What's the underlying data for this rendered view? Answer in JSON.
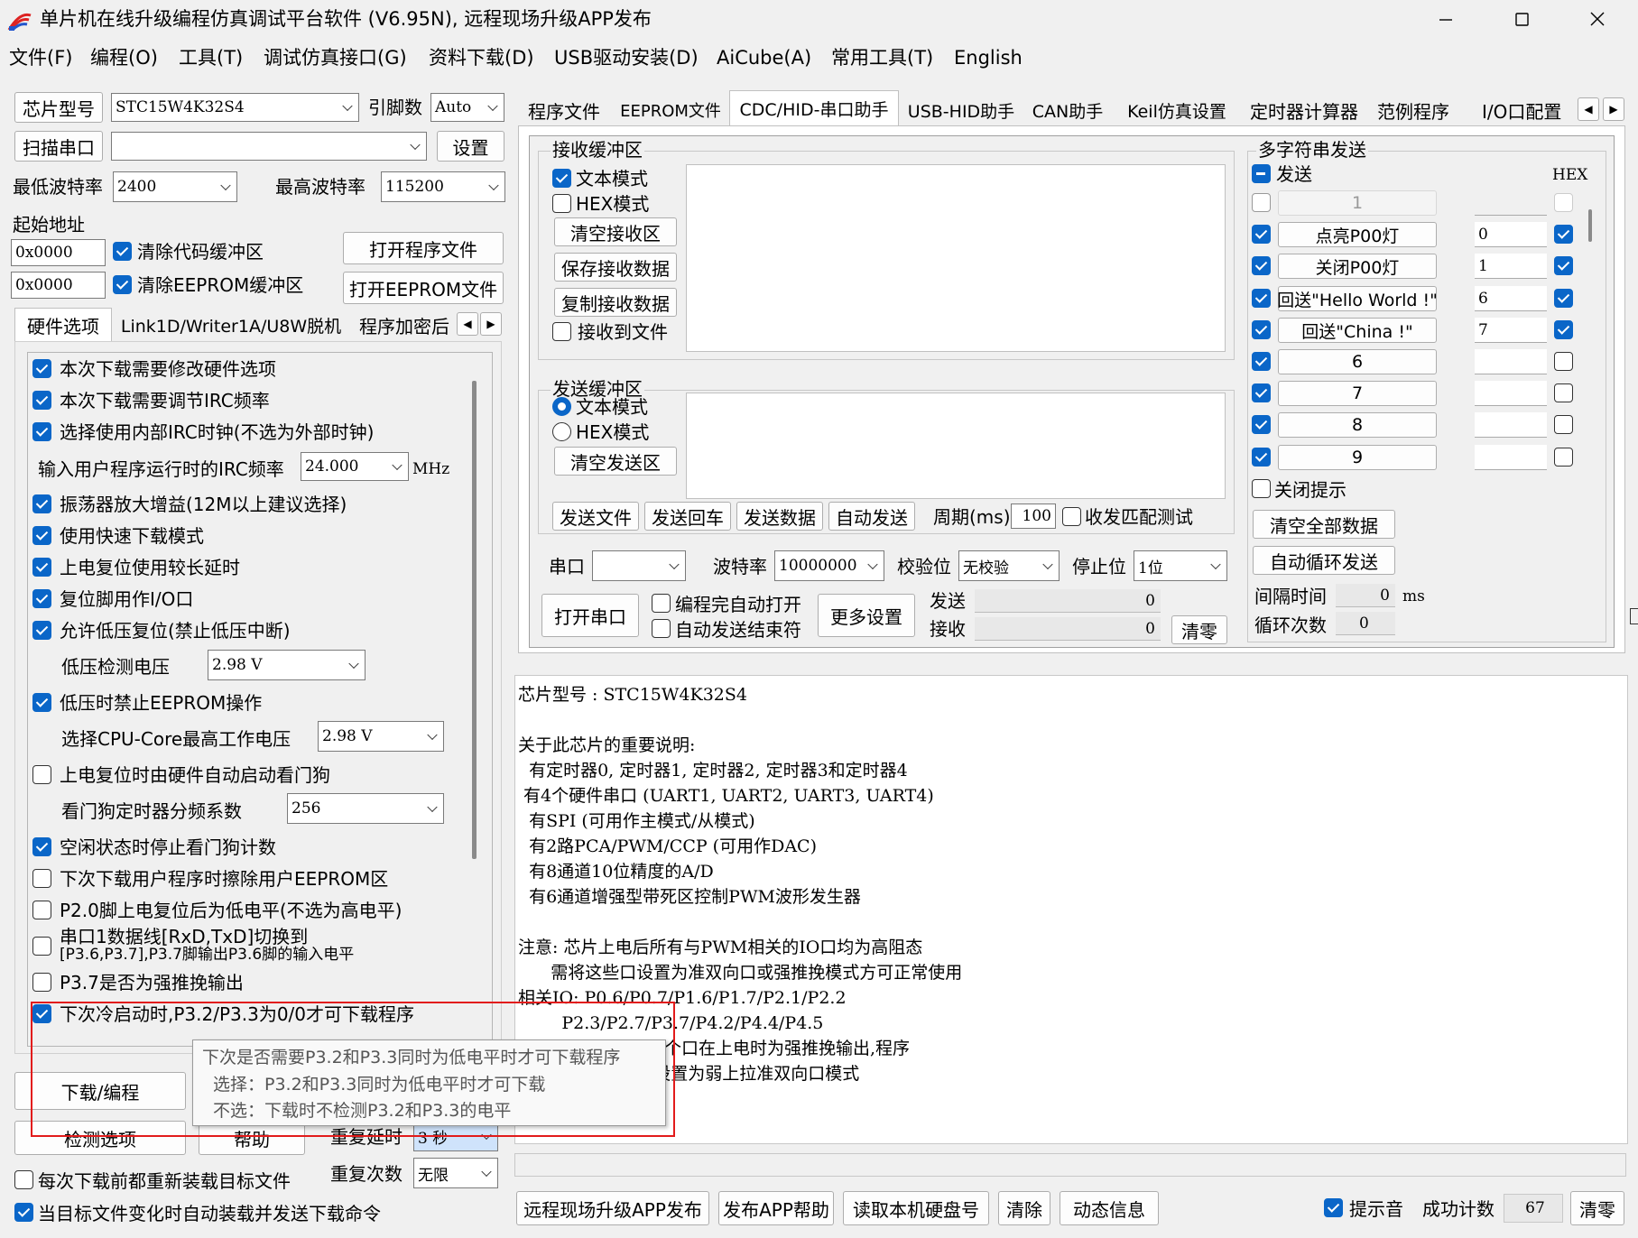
{
  "window": {
    "title": "单片机在线升级编程仿真调试平台软件 (V6.95N), 远程现场升级APP发布",
    "min_icon": "minimize-icon",
    "max_icon": "maximize-icon",
    "close_icon": "close-icon"
  },
  "menubar": [
    "文件(F)",
    "编程(O)",
    "工具(T)",
    "调试仿真接口(G)",
    "资料下载(D)",
    "USB驱动安装(D)",
    "AiCube(A)",
    "常用工具(T)",
    "English"
  ],
  "left": {
    "chip_label": "芯片型号",
    "chip_value": "STC15W4K32S4",
    "pin_label": "引脚数",
    "pin_value": "Auto",
    "scan_port": "扫描串口",
    "port_value": "",
    "settings": "设置",
    "min_baud_label": "最低波特率",
    "min_baud": "2400",
    "max_baud_label": "最高波特率",
    "max_baud": "115200",
    "start_addr_label": "起始地址",
    "addr1": "0x0000",
    "clear_code": "清除代码缓冲区",
    "open_prog": "打开程序文件",
    "addr2": "0x0000",
    "clear_eeprom": "清除EEPROM缓冲区",
    "open_eeprom": "打开EEPROM文件",
    "tabs": [
      "硬件选项",
      "Link1D/Writer1A/U8W脱机",
      "程序加密后"
    ],
    "options": [
      {
        "text": "本次下载需要修改硬件选项",
        "checked": true
      },
      {
        "text": "本次下载需要调节IRC频率",
        "checked": true
      },
      {
        "text": "选择使用内部IRC时钟(不选为外部时钟)",
        "checked": true
      },
      {
        "text": "振荡器放大增益(12M以上建议选择)",
        "checked": true
      },
      {
        "text": "使用快速下载模式",
        "checked": true
      },
      {
        "text": "上电复位使用较长延时",
        "checked": true
      },
      {
        "text": "复位脚用作I/O口",
        "checked": true
      },
      {
        "text": "允许低压复位(禁止低压中断)",
        "checked": true
      },
      {
        "text": "低压时禁止EEPROM操作",
        "checked": true
      },
      {
        "text": "上电复位时由硬件自动启动看门狗",
        "checked": false
      },
      {
        "text": "空闲状态时停止看门狗计数",
        "checked": true
      },
      {
        "text": "下次下载用户程序时擦除用户EEPROM区",
        "checked": false
      },
      {
        "text": "P2.0脚上电复位后为低电平(不选为高电平)",
        "checked": false
      },
      {
        "text": "串口1数据线[RxD,TxD]切换到",
        "text2": "[P3.6,P3.7],P3.7脚输出P3.6脚的输入电平",
        "checked": false
      },
      {
        "text": "P3.7是否为强推挽输出",
        "checked": false
      },
      {
        "text": "下次冷启动时,P3.2/P3.3为0/0才可下载程序",
        "checked": true
      }
    ],
    "irc_label": "输入用户程序运行时的IRC频率",
    "irc_value": "24.000",
    "irc_unit": "MHz",
    "lvd_label": "低压检测电压",
    "lvd_value": "2.98 V",
    "cpu_label": "选择CPU-Core最高工作电压",
    "cpu_value": "2.98 V",
    "wdt_label": "看门狗定时器分频系数",
    "wdt_value": "256",
    "download_btn": "下载/编程",
    "detect_btn": "检测选项",
    "help_btn": "帮助",
    "delay_label": "重复延时",
    "delay_value": "3 秒",
    "count_label": "重复次数",
    "count_value": "无限",
    "reload_each": "每次下载前都重新装载目标文件",
    "auto_reload": "当目标文件变化时自动装载并发送下载命令"
  },
  "tooltip": {
    "line1": "下次是否需要P3.2和P3.3同时为低电平时才可下载程序",
    "line2": "选择：P3.2和P3.3同时为低电平时才可下载",
    "line3": "不选：下载时不检测P3.2和P3.3的电平"
  },
  "right": {
    "tabs": [
      "程序文件",
      "EEPROM文件",
      "CDC/HID-串口助手",
      "USB-HID助手",
      "CAN助手",
      "Keil仿真设置",
      "定时器计算器",
      "范例程序",
      "I/O口配置"
    ],
    "recv_title": "接收缓冲区",
    "text_mode": "文本模式",
    "hex_mode": "HEX模式",
    "clear_recv": "清空接收区",
    "save_recv": "保存接收数据",
    "copy_recv": "复制接收数据",
    "recv_to_file": "接收到文件",
    "send_title": "发送缓冲区",
    "clear_send": "清空发送区",
    "send_file": "发送文件",
    "send_cr": "发送回车",
    "send_data": "发送数据",
    "auto_send": "自动发送",
    "period_label": "周期(ms)",
    "period_value": "100",
    "match_test": "收发匹配测试",
    "port_label": "串口",
    "baud_label": "波特率",
    "baud_value": "10000000",
    "parity_label": "校验位",
    "parity_value": "无校验",
    "stop_label": "停止位",
    "stop_value": "1位",
    "open_port": "打开串口",
    "auto_open": "编程完自动打开",
    "auto_end": "自动发送结束符",
    "more_settings": "更多设置",
    "send_label": "发送",
    "send_count": "0",
    "recv_label": "接收",
    "recv_count": "0",
    "clear_counts": "清零",
    "multi_title": "多字符串发送",
    "send_col": "发送",
    "hex_col": "HEX",
    "multi_rows": [
      {
        "label": "1",
        "value": "",
        "checked": false,
        "hex": false,
        "disabled": true
      },
      {
        "label": "点亮P00灯",
        "value": "0",
        "checked": true,
        "hex": true
      },
      {
        "label": "关闭P00灯",
        "value": "1",
        "checked": true,
        "hex": true
      },
      {
        "label": "回送\"Hello World !\"",
        "value": "6",
        "checked": true,
        "hex": true
      },
      {
        "label": "回送\"China !\"",
        "value": "7",
        "checked": true,
        "hex": true
      },
      {
        "label": "6",
        "value": "",
        "checked": true,
        "hex": false
      },
      {
        "label": "7",
        "value": "",
        "checked": true,
        "hex": false
      },
      {
        "label": "8",
        "value": "",
        "checked": true,
        "hex": false
      },
      {
        "label": "9",
        "value": "",
        "checked": true,
        "hex": false
      }
    ],
    "close_hint": "关闭提示",
    "clear_all": "清空全部数据",
    "auto_loop": "自动循环发送",
    "interval_label": "间隔时间",
    "interval_value": "0",
    "interval_unit": "ms",
    "loop_label": "循环次数",
    "loop_value": "0"
  },
  "info": {
    "lines": [
      "芯片型号 : STC15W4K32S4",
      "",
      "关于此芯片的重要说明:",
      "  有定时器0, 定时器1, 定时器2, 定时器3和定时器4",
      " 有4个硬件串口 (UART1, UART2, UART3, UART4)",
      "  有SPI (可用作主模式/从模式)",
      "  有2路PCA/PWM/CCP (可用作DAC)",
      "  有8通道10位精度的A/D",
      "  有6通道增强型带死区控制PWM波形发生器",
      "",
      "注意: 芯片上电后所有与PWM相关的IO口均为高阻态",
      "      需将这些口设置为准双向口或强推挽模式方可正常使用",
      "相关IO: P0.6/P0.7/P1.6/P1.7/P2.1/P2.2",
      "        P2.3/P2.7/P3.7/P4.2/P4.4/P4.5",
      "另外P1.0和P1.4两个口在上电时为强推挽输出,程序",
      "      需将这两个口设置为弱上拉准双向口模式"
    ]
  },
  "bottom": {
    "remote_upgrade": "远程现场升级APP发布",
    "publish_help": "发布APP帮助",
    "read_disk": "读取本机硬盘号",
    "clear": "清除",
    "dynamic_info": "动态信息",
    "sound": "提示音",
    "success_label": "成功计数",
    "success_value": "67",
    "reset": "清零"
  }
}
